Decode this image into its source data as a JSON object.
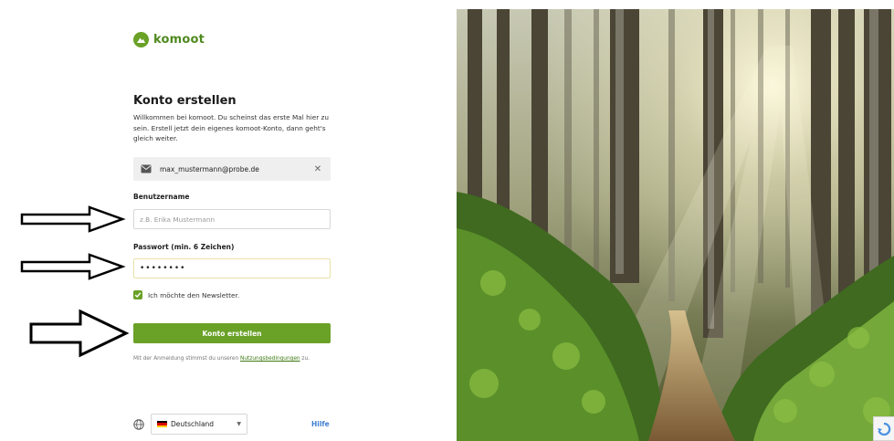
{
  "brand": {
    "name": "komoot",
    "color": "#6aa127"
  },
  "form": {
    "title": "Konto erstellen",
    "intro": "Willkommen bei komoot. Du scheinst das erste Mal hier zu sein. Erstell jetzt dein eigenes komoot-Konto, dann geht's gleich weiter.",
    "email": "max_mustermann@probe.de",
    "username_label": "Benutzername",
    "username_placeholder": "z.B. Erika Mustermann",
    "username_value": "",
    "password_label": "Passwort (min. 6 Zeichen)",
    "password_value": "••••••••",
    "newsletter_label": "Ich möchte den Newsletter.",
    "newsletter_checked": true,
    "submit_label": "Konto erstellen",
    "terms_prefix": "Mit der Anmeldung stimmst du unseren ",
    "terms_link": "Nutzungsbedingungen",
    "terms_suffix": " zu."
  },
  "footer": {
    "language": "Deutschland",
    "help_label": "Hilfe"
  },
  "icons": {
    "logo": "komoot-logo-icon",
    "email": "mail-icon",
    "clear": "close-icon",
    "check": "checkmark-icon",
    "globe": "globe-icon",
    "caret": "chevron-down-icon",
    "flag": "germany-flag-icon",
    "annotation": "arrow-right-icon",
    "recaptcha": "recaptcha-icon"
  }
}
